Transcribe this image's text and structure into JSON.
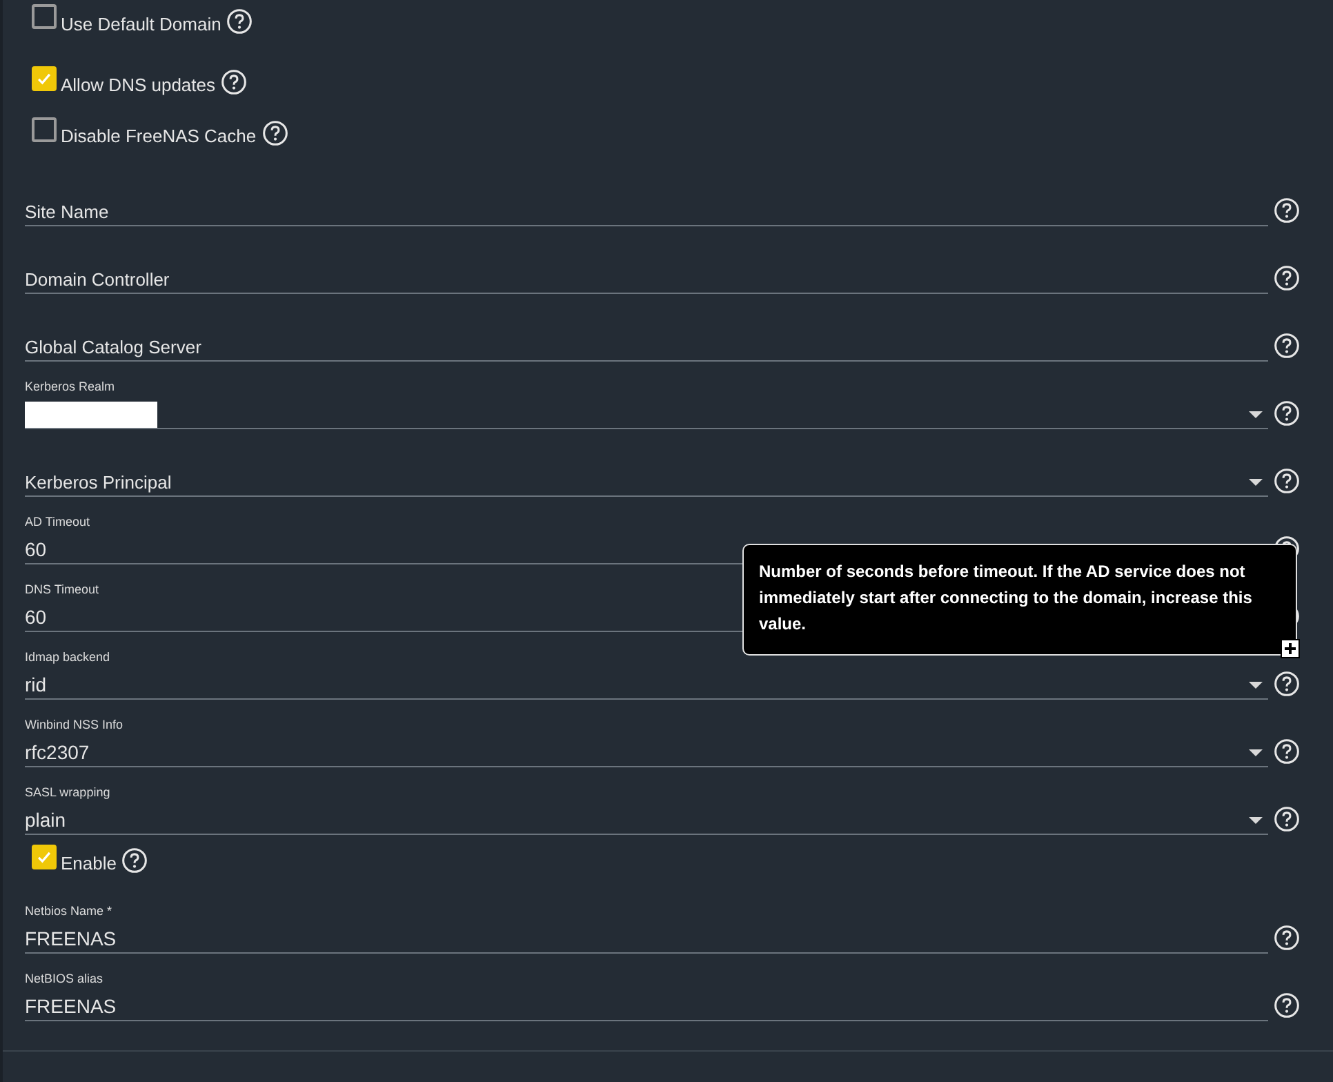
{
  "items": [
    {
      "kind": "checkbox",
      "label": "Use Default Domain",
      "checked": false
    },
    {
      "kind": "checkbox",
      "label": "Allow DNS updates",
      "checked": true
    },
    {
      "kind": "checkbox",
      "label": "Disable FreeNAS Cache",
      "checked": false
    },
    {
      "kind": "input",
      "label": "Site Name"
    },
    {
      "kind": "input",
      "label": "Domain Controller"
    },
    {
      "kind": "input",
      "label": "Global Catalog Server"
    },
    {
      "kind": "select",
      "label": "Kerberos Realm",
      "redacted": true
    },
    {
      "kind": "select",
      "label": "Kerberos Principal"
    },
    {
      "kind": "input",
      "label": "AD Timeout",
      "value": "60"
    },
    {
      "kind": "input",
      "label": "DNS Timeout",
      "value": "60"
    },
    {
      "kind": "select",
      "label": "Idmap backend",
      "value": "rid"
    },
    {
      "kind": "select",
      "label": "Winbind NSS Info",
      "value": "rfc2307"
    },
    {
      "kind": "select",
      "label": "SASL wrapping",
      "value": "plain"
    },
    {
      "kind": "checkbox",
      "label": "Enable",
      "checked": true
    },
    {
      "kind": "input",
      "label": "Netbios Name *",
      "value": "FREENAS"
    },
    {
      "kind": "input",
      "label": "NetBIOS alias",
      "value": "FREENAS"
    }
  ],
  "tooltip": {
    "text": "Number of seconds before timeout. If the AD service does not immediately start after connecting to the domain, increase this value."
  }
}
